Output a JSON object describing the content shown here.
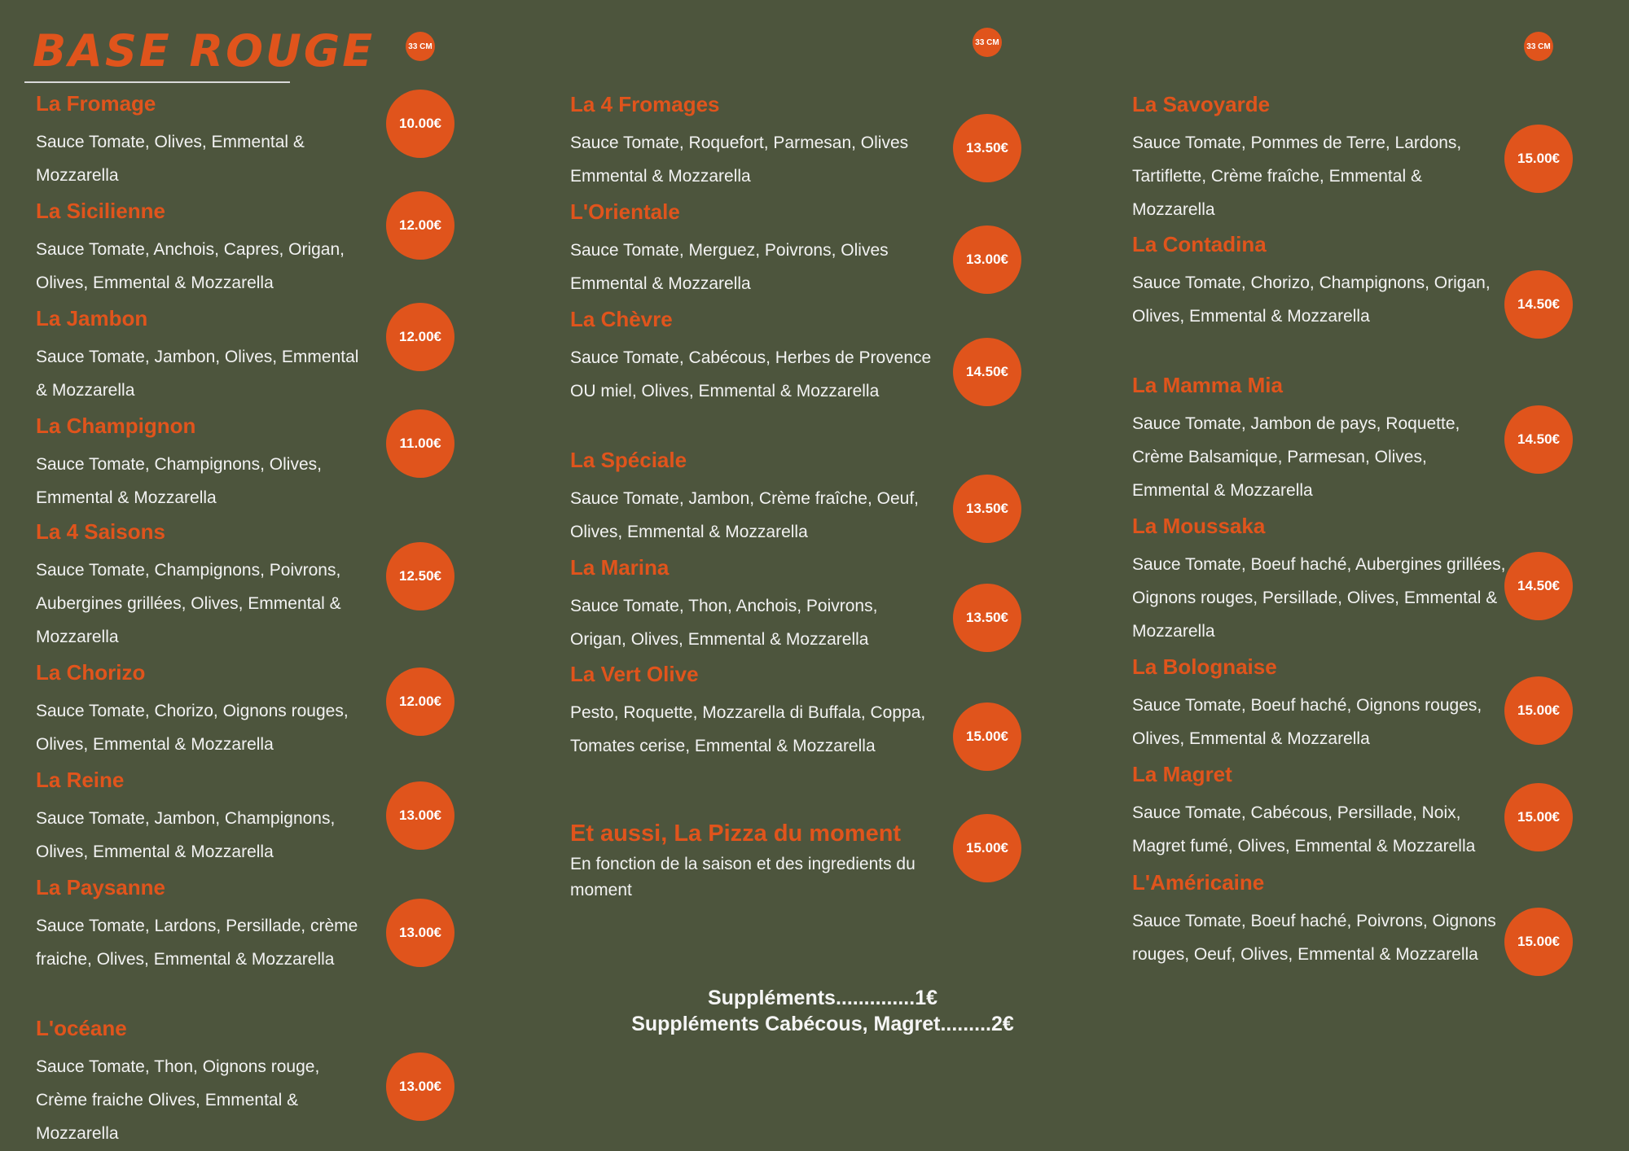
{
  "title": "BASE ROUGE",
  "size_badges": [
    "33 CM",
    "33 CM",
    "33 CM"
  ],
  "columns": [
    [
      {
        "name": "La Fromage",
        "desc": "Sauce Tomate, Olives, Emmental & Mozzarella",
        "price": "10.00€"
      },
      {
        "name": "La Sicilienne",
        "desc": "Sauce Tomate, Anchois, Capres, Origan, Olives, Emmental & Mozzarella",
        "price": "12.00€"
      },
      {
        "name": "La Jambon",
        "desc": "Sauce Tomate, Jambon, Olives, Emmental & Mozzarella",
        "price": "12.00€"
      },
      {
        "name": "La Champignon",
        "desc": "Sauce Tomate, Champignons, Olives, Emmental & Mozzarella",
        "price": "11.00€"
      },
      {
        "name": "La 4 Saisons",
        "desc": "Sauce Tomate, Champignons, Poivrons, Aubergines grillées, Olives, Emmental & Mozzarella",
        "price": "12.50€"
      },
      {
        "name": "La Chorizo",
        "desc": "Sauce Tomate, Chorizo, Oignons rouges, Olives, Emmental & Mozzarella",
        "price": "12.00€"
      },
      {
        "name": "La Reine",
        "desc": "Sauce Tomate, Jambon, Champignons, Olives, Emmental & Mozzarella",
        "price": "13.00€"
      },
      {
        "name": "La Paysanne",
        "desc": "Sauce Tomate, Lardons, Persillade, crème fraiche, Olives, Emmental & Mozzarella",
        "price": "13.00€"
      },
      {
        "name": "L'océane",
        "desc": "Sauce Tomate, Thon, Oignons rouge, Crème fraiche Olives, Emmental & Mozzarella",
        "price": "13.00€"
      }
    ],
    [
      {
        "name": "La 4 Fromages",
        "desc": "Sauce Tomate, Roquefort, Parmesan, Olives Emmental & Mozzarella",
        "price": "13.50€"
      },
      {
        "name": "L'Orientale",
        "desc": "Sauce Tomate, Merguez, Poivrons, Olives Emmental & Mozzarella",
        "price": "13.00€"
      },
      {
        "name": "La Chèvre",
        "desc": "Sauce Tomate, Cabécous, Herbes de Provence OU miel, Olives, Emmental & Mozzarella",
        "price": "14.50€"
      },
      {
        "name": "La Spéciale",
        "desc": "Sauce Tomate, Jambon, Crème fraîche, Oeuf, Olives, Emmental & Mozzarella",
        "price": "13.50€"
      },
      {
        "name": "La Marina",
        "desc": "Sauce Tomate, Thon, Anchois, Poivrons, Origan, Olives, Emmental & Mozzarella",
        "price": "13.50€"
      },
      {
        "name": "La Vert Olive",
        "desc": "Pesto, Roquette, Mozzarella di Buffala, Coppa, Tomates cerise, Emmental & Mozzarella",
        "price": "15.00€"
      }
    ],
    [
      {
        "name": "La Savoyarde",
        "desc": "Sauce Tomate, Pommes de Terre, Lardons, Tartiflette, Crème fraîche, Emmental & Mozzarella",
        "price": "15.00€"
      },
      {
        "name": "La Contadina",
        "desc": "Sauce Tomate, Chorizo, Champignons, Origan, Olives, Emmental & Mozzarella",
        "price": "14.50€"
      },
      {
        "name": "La Mamma Mia",
        "desc": "Sauce Tomate, Jambon de pays, Roquette, Crème Balsamique, Parmesan, Olives, Emmental & Mozzarella",
        "price": "14.50€"
      },
      {
        "name": "La Moussaka",
        "desc": "Sauce Tomate, Boeuf haché, Aubergines grillées, Oignons rouges, Persillade, Olives, Emmental & Mozzarella",
        "price": "14.50€"
      },
      {
        "name": "La Bolognaise",
        "desc": "Sauce Tomate, Boeuf haché, Oignons rouges, Olives, Emmental & Mozzarella",
        "price": "15.00€"
      },
      {
        "name": "La Magret",
        "desc": "Sauce Tomate, Cabécous, Persillade, Noix, Magret fumé, Olives, Emmental & Mozzarella",
        "price": "15.00€"
      },
      {
        "name": "L'Américaine",
        "desc": "Sauce Tomate, Boeuf haché, Poivrons, Oignons rouges, Oeuf, Olives, Emmental & Mozzarella",
        "price": "15.00€"
      }
    ]
  ],
  "special": {
    "name": "Et aussi, La Pizza du moment",
    "desc": "En fonction de la saison et des ingredients du moment",
    "price": "15.00€"
  },
  "supplements": [
    "Suppléments..............1€",
    "Suppléments Cabécous, Magret.........2€"
  ]
}
